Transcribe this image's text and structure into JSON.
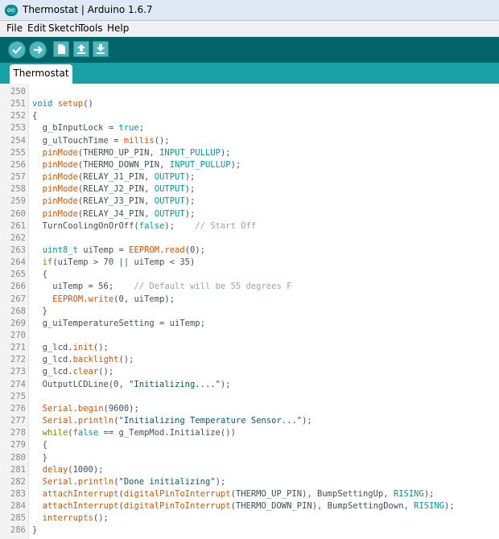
{
  "window": {
    "title": "Thermostat | Arduino 1.6.7"
  },
  "app_icon_text": "oo",
  "menu": [
    "File",
    "Edit",
    "Sketch",
    "Tools",
    "Help"
  ],
  "toolbar": {
    "buttons": [
      {
        "name": "verify",
        "icon": "check-icon"
      },
      {
        "name": "upload",
        "icon": "arrow-right-icon"
      },
      {
        "name": "new",
        "icon": "new-file-icon"
      },
      {
        "name": "open",
        "icon": "open-arrow-up-icon"
      },
      {
        "name": "save",
        "icon": "save-arrow-down-icon"
      }
    ]
  },
  "tabs": [
    {
      "label": "Thermostat",
      "active": true
    }
  ],
  "colors": {
    "toolbar_bg": "#006468",
    "tab_strip_bg": "#17a1a5",
    "keyword": "#00979c",
    "function": "#d35400",
    "comment": "#95a5a6"
  },
  "code": [
    {
      "n": "250",
      "t": ""
    },
    {
      "n": "251",
      "t": "void setup()"
    },
    {
      "n": "252",
      "t": "{"
    },
    {
      "n": "253",
      "t": "  g_bInputLock = true;"
    },
    {
      "n": "254",
      "t": "  g_ulTouchTime = millis();"
    },
    {
      "n": "255",
      "t": "  pinMode(THERMO_UP_PIN, INPUT_PULLUP);"
    },
    {
      "n": "256",
      "t": "  pinMode(THERMO_DOWN_PIN, INPUT_PULLUP);"
    },
    {
      "n": "257",
      "t": "  pinMode(RELAY_J1_PIN, OUTPUT);"
    },
    {
      "n": "258",
      "t": "  pinMode(RELAY_J2_PIN, OUTPUT);"
    },
    {
      "n": "259",
      "t": "  pinMode(RELAY_J3_PIN, OUTPUT);"
    },
    {
      "n": "260",
      "t": "  pinMode(RELAY_J4_PIN, OUTPUT);"
    },
    {
      "n": "261",
      "t": "  TurnCoolingOnOrOff(false);    // Start Off"
    },
    {
      "n": "262",
      "t": ""
    },
    {
      "n": "263",
      "t": "  uint8_t uiTemp = EEPROM.read(0);"
    },
    {
      "n": "264",
      "t": "  if(uiTemp > 70 || uiTemp < 35)"
    },
    {
      "n": "265",
      "t": "  {"
    },
    {
      "n": "266",
      "t": "    uiTemp = 56;    // Default will be 55 degrees F"
    },
    {
      "n": "267",
      "t": "    EEPROM.write(0, uiTemp);"
    },
    {
      "n": "268",
      "t": "  }"
    },
    {
      "n": "269",
      "t": "  g_uiTemperatureSetting = uiTemp;"
    },
    {
      "n": "270",
      "t": ""
    },
    {
      "n": "271",
      "t": "  g_lcd.init();"
    },
    {
      "n": "272",
      "t": "  g_lcd.backlight();"
    },
    {
      "n": "273",
      "t": "  g_lcd.clear();"
    },
    {
      "n": "274",
      "t": "  OutputLCDLine(0, \"Initializing....\");"
    },
    {
      "n": "275",
      "t": ""
    },
    {
      "n": "276",
      "t": "  Serial.begin(9600);"
    },
    {
      "n": "277",
      "t": "  Serial.println(\"Initializing Temperature Sensor...\");"
    },
    {
      "n": "278",
      "t": "  while(false == g_TempMod.Initialize())"
    },
    {
      "n": "279",
      "t": "  {"
    },
    {
      "n": "280",
      "t": "  }"
    },
    {
      "n": "281",
      "t": "  delay(1000);"
    },
    {
      "n": "282",
      "t": "  Serial.println(\"Done initializing\");"
    },
    {
      "n": "283",
      "t": "  attachInterrupt(digitalPinToInterrupt(THERMO_UP_PIN), BumpSettingUp, RISING);"
    },
    {
      "n": "284",
      "t": "  attachInterrupt(digitalPinToInterrupt(THERMO_DOWN_PIN), BumpSettingDown, RISING);"
    },
    {
      "n": "285",
      "t": "  interrupts();"
    },
    {
      "n": "286",
      "t": "}"
    }
  ]
}
